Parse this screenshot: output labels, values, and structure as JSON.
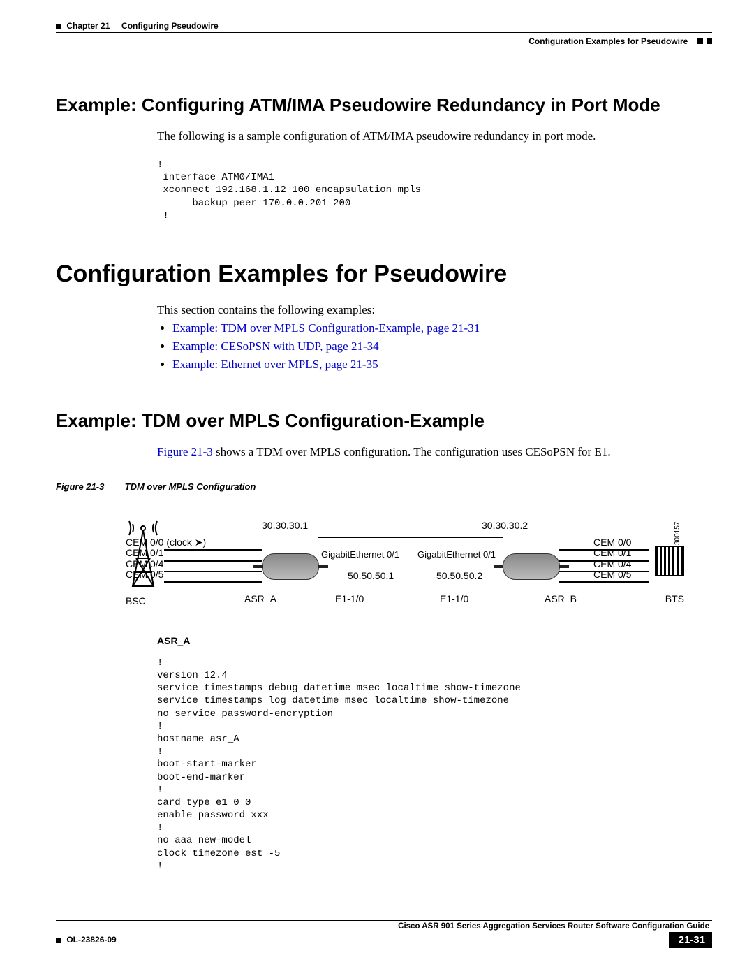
{
  "header": {
    "chapter_label": "Chapter 21",
    "chapter_title": "Configuring Pseudowire",
    "section_title": "Configuration Examples for Pseudowire"
  },
  "sec1": {
    "heading": "Example: Configuring ATM/IMA Pseudowire Redundancy in Port Mode",
    "intro": "The following is a sample configuration of ATM/IMA pseudowire redundancy in port mode.",
    "code": "!\n interface ATM0/IMA1\n xconnect 192.168.1.12 100 encapsulation mpls\n      backup peer 170.0.0.201 200\n !"
  },
  "sec2": {
    "heading": "Configuration Examples for Pseudowire",
    "intro": "This section contains the following examples:",
    "links": [
      "Example: TDM over MPLS Configuration-Example, page 21-31",
      "Example: CESoPSN with UDP, page 21-34",
      "Example: Ethernet over MPLS, page 21-35"
    ]
  },
  "sec3": {
    "heading": "Example: TDM over MPLS Configuration-Example",
    "xref": "Figure 21-3",
    "intro_rest": " shows a TDM over MPLS configuration. The configuration uses CESoPSN for E1.",
    "fig_num": "Figure 21-3",
    "fig_title": "TDM over MPLS Configuration"
  },
  "diagram": {
    "ip_left_top": "30.30.30.1",
    "ip_right_top": "30.30.30.2",
    "cem_left": [
      "CEM 0/0 (clock ➤)",
      "CEM 0/1",
      "CEM 0/4",
      "CEM 0/5"
    ],
    "cem_right": [
      "CEM 0/0",
      "CEM 0/1",
      "CEM 0/4",
      "CEM 0/5"
    ],
    "ge_left": "GigabitEthernet 0/1",
    "ge_right": "GigabitEthernet 0/1",
    "ip_left_bot": "50.50.50.1",
    "ip_right_bot": "50.50.50.2",
    "e1_left": "E1-1/0",
    "e1_right": "E1-1/0",
    "bsc": "BSC",
    "asr_a": "ASR_A",
    "asr_b": "ASR_B",
    "bts": "BTS",
    "id": "300157"
  },
  "asr": {
    "label": "ASR_A",
    "code": "!\nversion 12.4\nservice timestamps debug datetime msec localtime show-timezone\nservice timestamps log datetime msec localtime show-timezone\nno service password-encryption\n!\nhostname asr_A\n!\nboot-start-marker\nboot-end-marker\n!\ncard type e1 0 0\nenable password xxx\n!\nno aaa new-model\nclock timezone est -5\n!"
  },
  "footer": {
    "guide": "Cisco ASR 901 Series Aggregation Services Router Software Configuration Guide",
    "docnum": "OL-23826-09",
    "pagenum": "21-31"
  }
}
